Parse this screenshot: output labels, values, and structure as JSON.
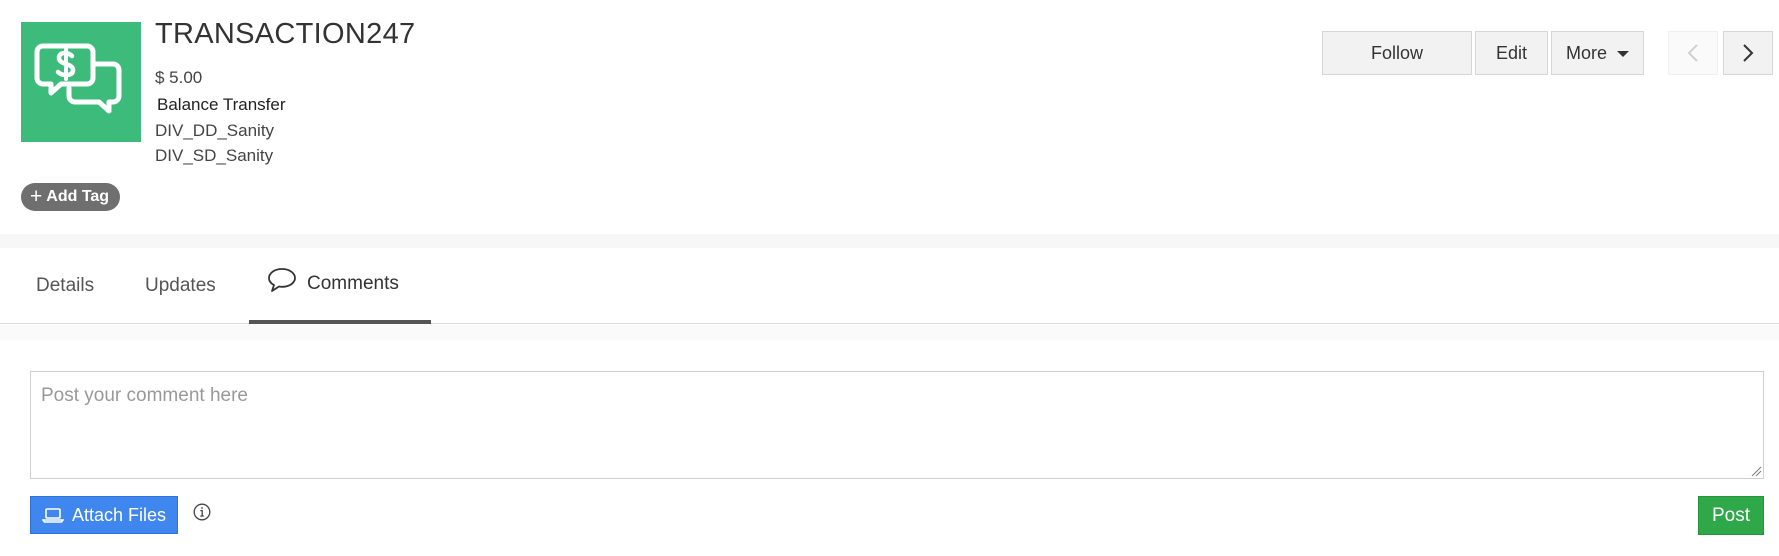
{
  "record": {
    "title": "TRANSACTION247",
    "amount": "$ 5.00",
    "type": "Balance Transfer",
    "division_1": "DIV_DD_Sanity",
    "division_2": "DIV_SD_Sanity",
    "logo_icon": "dollar-chat-icon",
    "logo_color": "#3dbb7b"
  },
  "tag": {
    "add_label": "Add Tag",
    "icon": "plus-icon"
  },
  "actions": {
    "follow_label": "Follow",
    "edit_label": "Edit",
    "more_label": "More",
    "prev_icon": "chevron-left-icon",
    "next_icon": "chevron-right-icon"
  },
  "tabs": [
    {
      "label": "Details",
      "active": false
    },
    {
      "label": "Updates",
      "active": false
    },
    {
      "label": "Comments",
      "active": true,
      "icon": "speech-bubble-icon"
    }
  ],
  "comment": {
    "placeholder": "Post your comment here",
    "value": "",
    "attach_label": "Attach Files",
    "attach_icon": "laptop-icon",
    "info_icon": "info-icon",
    "post_label": "Post"
  },
  "colors": {
    "attach": "#3f87ee",
    "post": "#2fa84a",
    "tag": "#6f6f6f"
  }
}
